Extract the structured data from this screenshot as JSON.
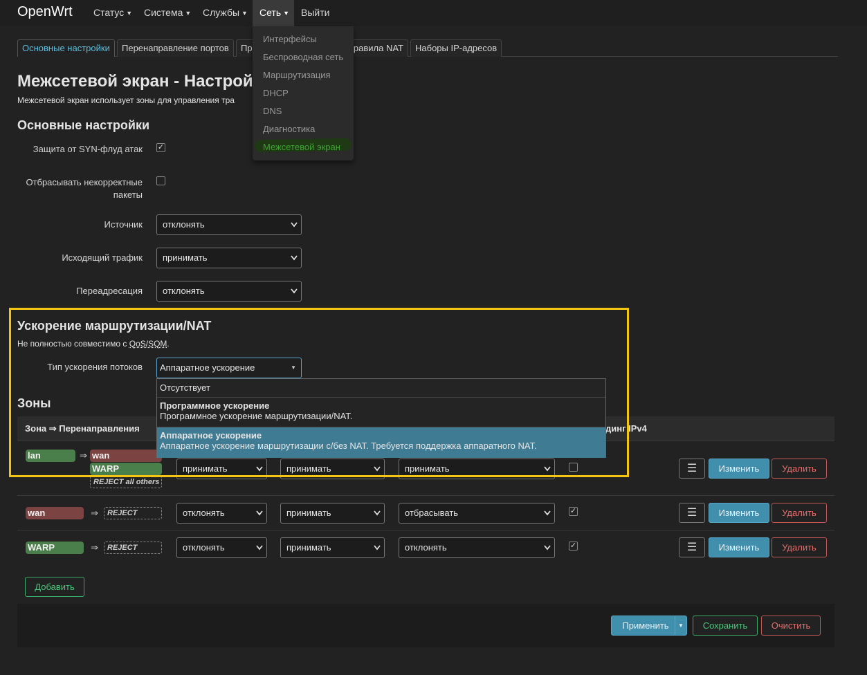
{
  "navbar": {
    "brand": "OpenWrt",
    "items": [
      "Статус",
      "Система",
      "Службы",
      "Сеть",
      "Выйти"
    ]
  },
  "net_menu": [
    "Интерфейсы",
    "Беспроводная сеть",
    "Маршрутизация",
    "DHCP",
    "DNS",
    "Диагностика",
    "Межсетевой экран"
  ],
  "tabs": [
    "Основные настройки",
    "Перенаправление портов",
    "Пр",
    "равила NAT",
    "Наборы IP-адресов"
  ],
  "page": {
    "title": "Межсетевой экран - Настрой",
    "description": "Межсетевой экран использует зоны для управления тра"
  },
  "general": {
    "heading": "Основные настройки",
    "syn_label": "Защита от SYN-флуд атак",
    "syn_checked": true,
    "invalid_label_1": "Отбрасывать некорректные",
    "invalid_label_2": "пакеты",
    "invalid_checked": false,
    "input_label": "Источник",
    "input_value": "отклонять",
    "output_label": "Исходящий трафик",
    "output_value": "принимать",
    "forward_label": "Переадресация",
    "forward_value": "отклонять"
  },
  "offload": {
    "heading": "Ускорение маршрутизации/NAT",
    "note_prefix": "Не полностью совместимо с ",
    "note_link": "QoS/SQM",
    "note_suffix": ".",
    "type_label": "Тип ускорения потоков",
    "selected": "Аппаратное ускорение",
    "options": [
      {
        "title": "Отсутствует",
        "desc": ""
      },
      {
        "title": "Программное ускорение",
        "desc": "Программное ускорение маршрутизации/NAT."
      },
      {
        "title": "Аппаратное ускорение",
        "desc": "Аппаратное ускорение маршрутизации с/без NAT. Требуется поддержка аппаратного NAT."
      }
    ]
  },
  "zones": {
    "heading": "Зоны",
    "col_zone": "Зона ⇒ Перенаправления",
    "col_masq_fragment": "динг IPv4",
    "arrow": "⇒",
    "rows": [
      {
        "zone": "lan",
        "forwards": [
          "wan",
          "WARP"
        ],
        "reject": "REJECT all others",
        "input": "принимать",
        "output": "принимать",
        "forward": "принимать",
        "masq": false
      },
      {
        "zone": "wan",
        "forwards": [],
        "reject": "REJECT",
        "input": "отклонять",
        "output": "принимать",
        "forward": "отбрасывать",
        "masq": true
      },
      {
        "zone": "WARP",
        "forwards": [],
        "reject": "REJECT",
        "input": "отклонять",
        "output": "принимать",
        "forward": "отклонять",
        "masq": true
      }
    ],
    "menu_glyph": "☰",
    "edit_label": "Изменить",
    "delete_label": "Удалить",
    "add_label": "Добавить"
  },
  "footer": {
    "apply_label": "Применить",
    "save_label": "Сохранить",
    "reset_label": "Очистить"
  },
  "colors": {
    "accent": "#3f8fad",
    "highlight_frame": "#f3c614",
    "zone_green": "#4a7e4a",
    "zone_red": "#7c4343"
  }
}
